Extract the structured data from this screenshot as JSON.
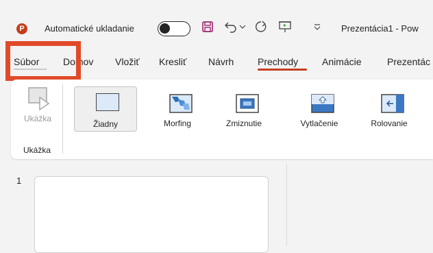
{
  "titlebar": {
    "logo_letter": "P",
    "autosave_label": "Automatické ukladanie",
    "autosave_state": "off",
    "document_title": "Prezentácia1 - Pow"
  },
  "tabs": [
    {
      "label": "Súbor"
    },
    {
      "label": "Domov"
    },
    {
      "label": "Vložiť"
    },
    {
      "label": "Kresliť"
    },
    {
      "label": "Návrh"
    },
    {
      "label": "Prechody",
      "active": true
    },
    {
      "label": "Animácie"
    },
    {
      "label": "Prezentác"
    }
  ],
  "ribbon": {
    "preview_button": "Ukážka",
    "preview_group": "Ukážka",
    "transitions": [
      {
        "label": "Žiadny",
        "selected": true
      },
      {
        "label": "Morfing"
      },
      {
        "label": "Zmiznutie"
      },
      {
        "label": "Vytlačenie"
      },
      {
        "label": "Rolovanie"
      }
    ]
  },
  "slides": {
    "first_number": "1"
  },
  "colors": {
    "accent": "#c43e1c",
    "highlight": "#e04a28",
    "thumb_fill": "#dbe9f8",
    "thumb_blue": "#3a78c2"
  }
}
